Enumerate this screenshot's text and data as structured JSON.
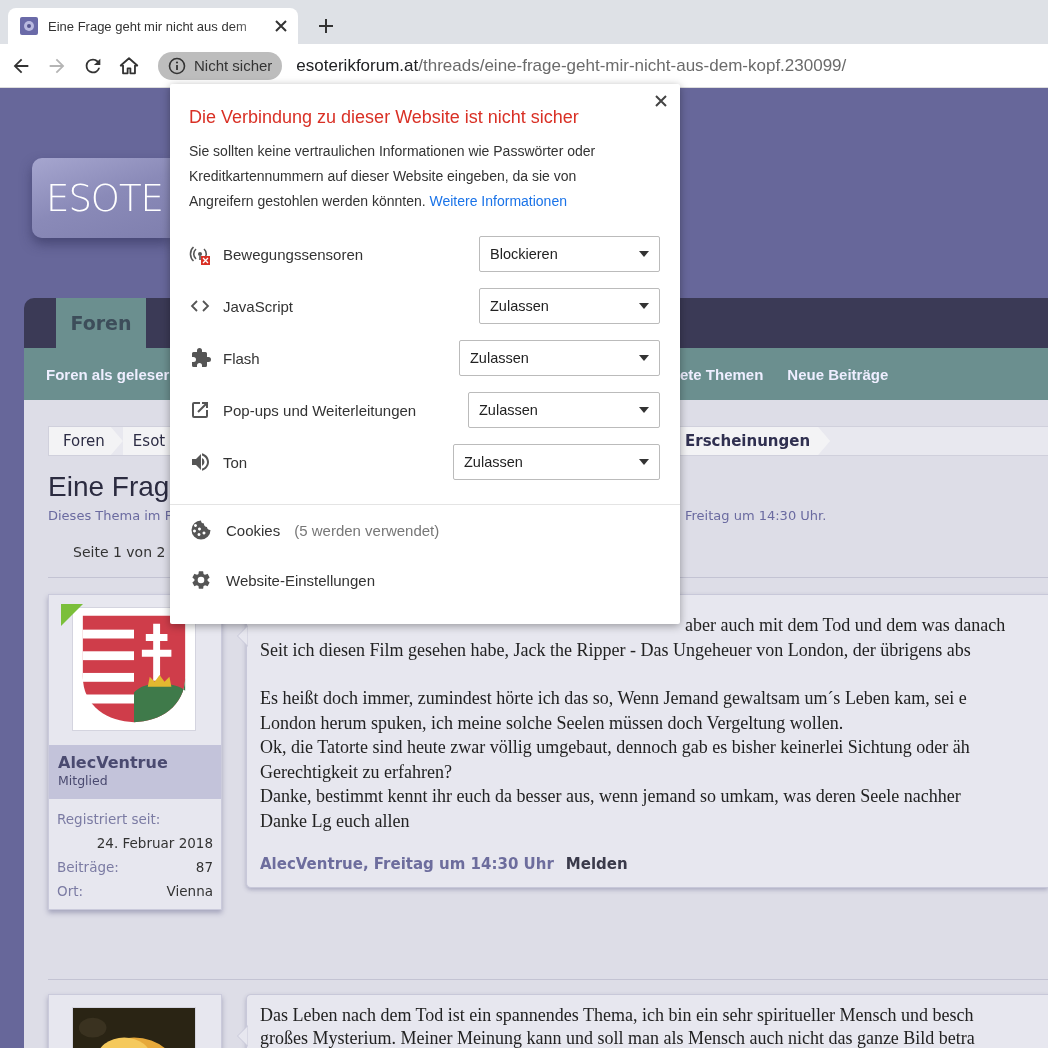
{
  "browser": {
    "tab": {
      "title": "Eine Frage geht mir nicht aus dem"
    },
    "address": {
      "security_label": "Nicht sicher",
      "host": "esoterikforum.at",
      "path": "/threads/eine-frage-geht-mir-nicht-aus-dem-kopf.230099/"
    }
  },
  "site": {
    "logo": "ESOTE",
    "nav_tabs": [
      {
        "label": "Foren",
        "selected": true
      }
    ],
    "subnav": {
      "left": [
        "Foren als geleser"
      ],
      "right": [
        "ete Themen",
        "Neue Beiträge"
      ]
    },
    "breadcrumbs": {
      "left": [
        "Foren",
        "Esot"
      ],
      "right": [
        "Erscheinungen"
      ]
    },
    "thread": {
      "title": "Eine Frag",
      "meta_left": "Dieses Thema im F",
      "meta_right": "Freitag um 14:30 Uhr.",
      "pages": "Seite 1 von 2"
    },
    "posts": [
      {
        "author": "AlecVentrue",
        "role": "Mitglied",
        "online": true,
        "avatar": {
          "kind": "coat_of_arms"
        },
        "info": [
          {
            "kind": "stacked",
            "label": "Registriert seit:",
            "value": "24. Februar 2018"
          },
          {
            "kind": "inline",
            "label": "Beiträge:",
            "value": "87"
          },
          {
            "kind": "inline",
            "label": "Ort:",
            "value": "Vienna"
          }
        ],
        "paragraphs": [
          [
            "aber auch mit dem Tod und dem was danach",
            "Seit ich diesen Film gesehen habe, Jack the Ripper - Das Ungeheuer von London, der übrigens abs"
          ],
          [
            "Es heißt doch immer, zumindest hörte ich das so, Wenn Jemand gewaltsam um´s Leben kam, sei e",
            "London herum spuken, ich meine solche Seelen müssen doch Vergeltung wollen.",
            "Ok, die Tatorte sind heute zwar völlig umgebaut, dennoch gab es bisher keinerlei Sichtung oder äh",
            "Gerechtigkeit zu erfahren?",
            "Danke, bestimmt kennt ihr euch da besser aus, wenn jemand so umkam, was deren Seele nachher",
            "Danke Lg euch allen"
          ]
        ],
        "footer": {
          "byline": "AlecVentrue, Freitag um 14:30 Uhr",
          "report": "Melden"
        }
      },
      {
        "online": false,
        "avatar": {
          "kind": "picture"
        },
        "paragraphs": [
          [
            "Das Leben nach dem Tod ist ein spannendes Thema, ich bin ein sehr spiritueller Mensch und besch",
            "großes Mysterium. Meiner Meinung kann und soll man als Mensch auch nicht das ganze Bild betra"
          ]
        ]
      }
    ]
  },
  "popup": {
    "title": "Die Verbindung zu dieser Website ist nicht sicher",
    "text": "Sie sollten keine vertraulichen Informationen wie Passwörter oder Kreditkartennummern auf dieser Website eingeben, da sie von Angreifern gestohlen werden könnten.",
    "link": "Weitere Informationen",
    "permissions": [
      {
        "kind": "sensors",
        "label": "Bewegungssensoren",
        "value": "Blockieren",
        "blocked": true
      },
      {
        "kind": "javascript",
        "label": "JavaScript",
        "value": "Zulassen",
        "blocked": false
      },
      {
        "kind": "flash",
        "label": "Flash",
        "value": "Zulassen",
        "blocked": false
      },
      {
        "kind": "popups",
        "label": "Pop-ups und Weiterleitungen",
        "value": "Zulassen",
        "blocked": false
      },
      {
        "kind": "sound",
        "label": "Ton",
        "value": "Zulassen",
        "blocked": false
      }
    ],
    "cookies": {
      "label": "Cookies",
      "detail": "(5 werden verwendet)"
    },
    "settings": {
      "label": "Website-Einstellungen"
    }
  }
}
